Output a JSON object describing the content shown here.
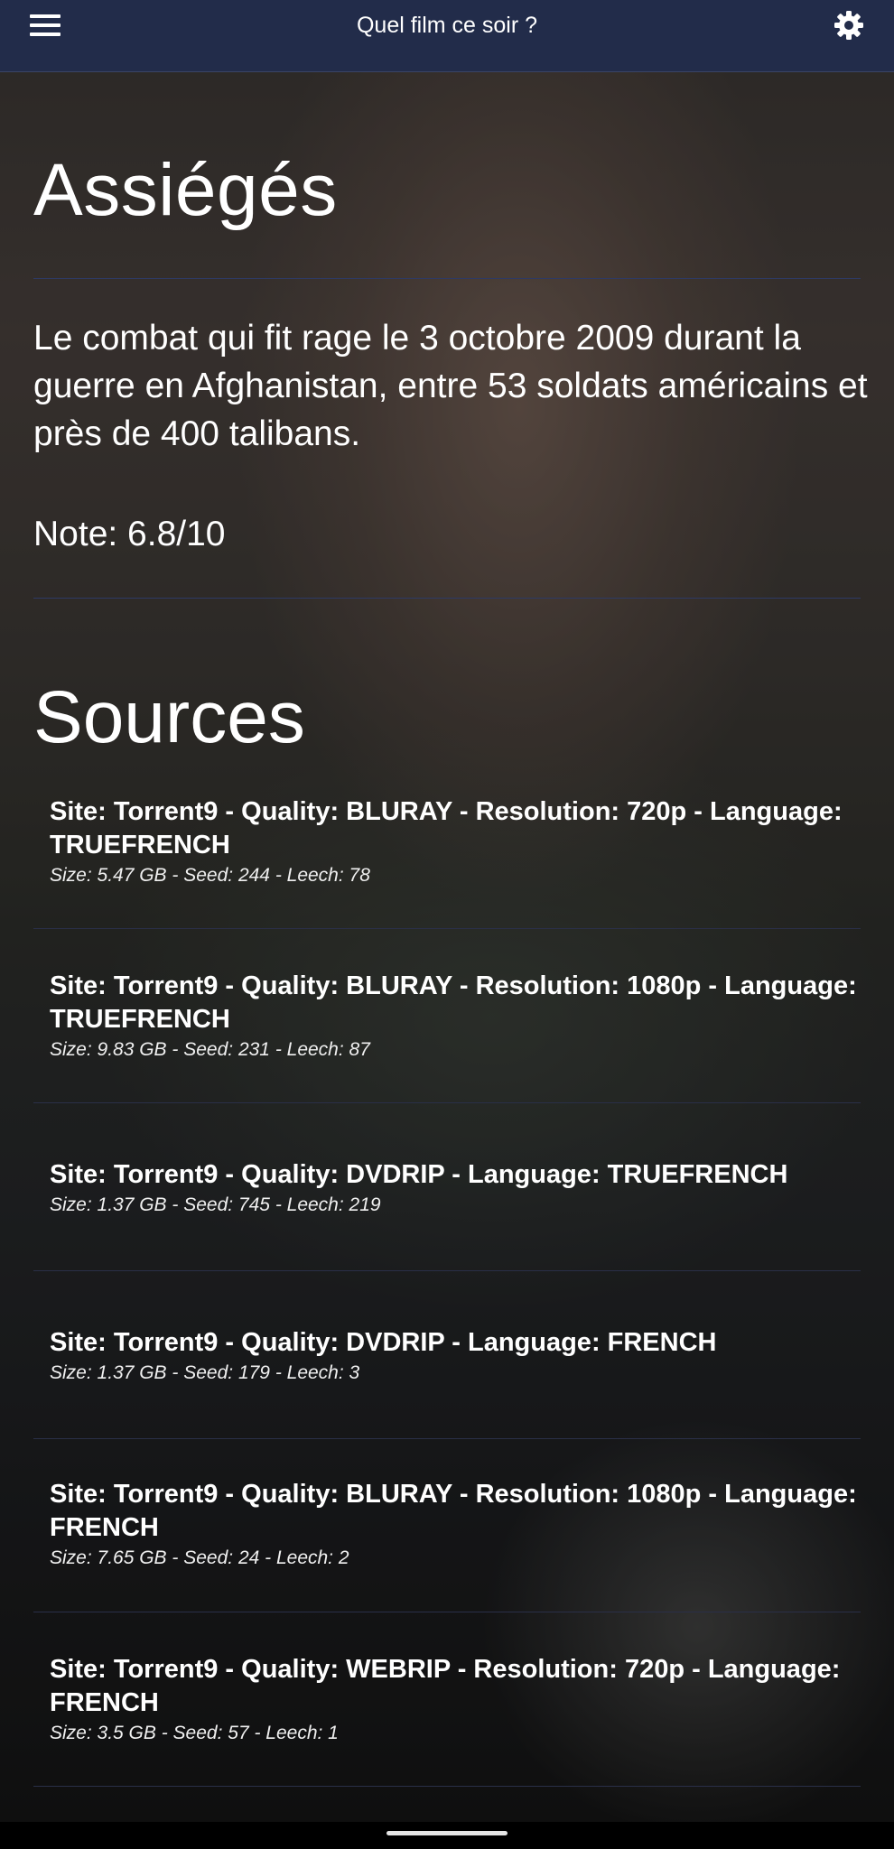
{
  "appbar": {
    "title": "Quel film ce soir ?",
    "menu_icon": "hamburger-menu-icon",
    "settings_icon": "gear-icon"
  },
  "movie": {
    "title": "Assiégés",
    "synopsis": "Le combat qui fit rage le 3 octobre 2009 durant la guerre en Afghanistan, entre 53 soldats américains et près de 400 talibans.",
    "rating": "Note: 6.8/10"
  },
  "sources": {
    "heading": "Sources",
    "items": [
      {
        "title": "Site: Torrent9 - Quality: BLURAY - Resolution: 720p - Language: TRUEFRENCH",
        "meta": "Size: 5.47 GB - Seed: 244 - Leech: 78"
      },
      {
        "title": "Site: Torrent9 - Quality: BLURAY - Resolution: 1080p - Language: TRUEFRENCH",
        "meta": "Size: 9.83 GB - Seed: 231 - Leech: 87"
      },
      {
        "title": "Site: Torrent9 - Quality: DVDRIP - Language: TRUEFRENCH",
        "meta": "Size: 1.37 GB - Seed: 745 - Leech: 219"
      },
      {
        "title": "Site: Torrent9 - Quality: DVDRIP - Language: FRENCH",
        "meta": "Size: 1.37 GB - Seed: 179 - Leech: 3"
      },
      {
        "title": "Site: Torrent9 - Quality: BLURAY - Resolution: 1080p - Language: FRENCH",
        "meta": "Size: 7.65 GB - Seed: 24 - Leech: 2"
      },
      {
        "title": "Site: Torrent9 - Quality: WEBRIP - Resolution: 720p - Language: FRENCH",
        "meta": "Size: 3.5 GB - Seed: 57 - Leech: 1"
      }
    ]
  },
  "colors": {
    "appbar_bg": "#222c4a",
    "divider": "#2e3a64",
    "text": "#ffffff"
  }
}
